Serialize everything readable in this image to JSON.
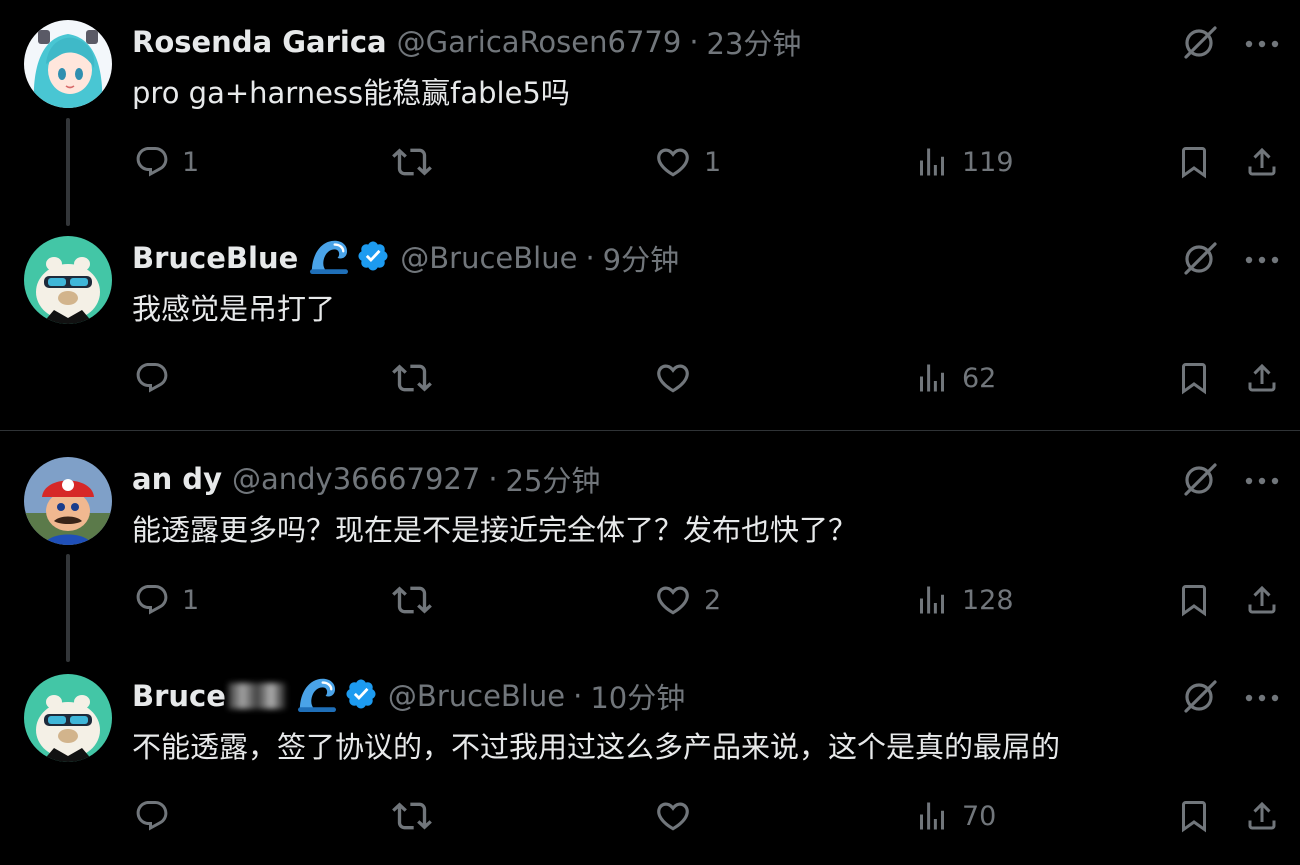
{
  "threads": [
    {
      "posts": [
        {
          "name": "Rosenda Garica",
          "handle": "@GaricaRosen6779",
          "separator": "·",
          "time": "23分钟",
          "content": "pro ga+harness能稳赢fable5吗",
          "replies": "1",
          "reposts": "",
          "likes": "1",
          "views": "119",
          "avatar": "anime-girl-avatar",
          "verified": false,
          "wave_emoji": false
        },
        {
          "name": "BruceBlue",
          "handle": "@BruceBlue",
          "separator": "·",
          "time": "9分钟",
          "content": "我感觉是吊打了",
          "replies": "",
          "reposts": "",
          "likes": "",
          "views": "62",
          "avatar": "capybara-sunglasses-avatar",
          "verified": true,
          "wave_emoji": true
        }
      ]
    },
    {
      "posts": [
        {
          "name": "an dy",
          "handle": "@andy36667927",
          "separator": "·",
          "time": "25分钟",
          "content": "能透露更多吗？现在是不是接近完全体了？发布也快了？",
          "replies": "1",
          "reposts": "",
          "likes": "2",
          "views": "128",
          "avatar": "mario-avatar",
          "verified": false,
          "wave_emoji": false
        },
        {
          "name": "Bruce",
          "handle": "@BruceBlue",
          "separator": "·",
          "time": "10分钟",
          "content": "不能透露，签了协议的，不过我用过这么多产品来说，这个是真的最屌的",
          "replies": "",
          "reposts": "",
          "likes": "",
          "views": "70",
          "avatar": "capybara-sunglasses-avatar",
          "verified": true,
          "wave_emoji": true,
          "name_partially_blurred": true
        }
      ]
    }
  ],
  "icons": {
    "reply": "reply-icon",
    "repost": "repost-icon",
    "like": "like-icon",
    "views": "views-icon",
    "bookmark": "bookmark-icon",
    "share": "share-icon",
    "grok": "grok-icon",
    "more": "more-icon"
  },
  "colors": {
    "background": "#000000",
    "text": "#e7e9ea",
    "muted": "#71767b",
    "verified": "#1d9bf0",
    "thread_line": "#333639"
  }
}
